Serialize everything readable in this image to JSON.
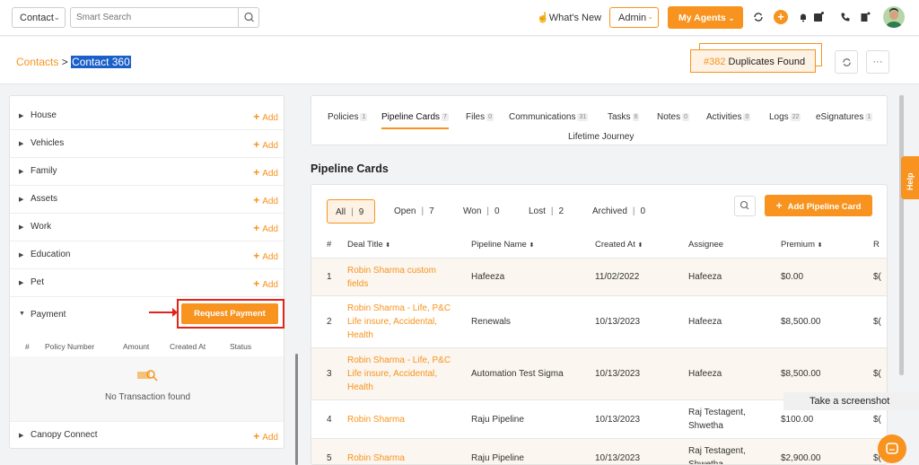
{
  "topbar": {
    "entity_select": "Contact",
    "search_placeholder": "Smart Search",
    "whats_new": "What's New",
    "admin_label": "Admin",
    "my_agents_label": "My Agents",
    "accent": "#f7931e"
  },
  "subbar": {
    "crumb_root": "Contacts",
    "crumb_sep": " > ",
    "crumb_current": "Contact 360",
    "dup_number": "#382",
    "dup_label": " Duplicates Found"
  },
  "left": {
    "rows": [
      {
        "label": "House",
        "add": "Add"
      },
      {
        "label": "Vehicles",
        "add": "Add"
      },
      {
        "label": "Family",
        "add": "Add"
      },
      {
        "label": "Assets",
        "add": "Add"
      },
      {
        "label": "Work",
        "add": "Add"
      },
      {
        "label": "Education",
        "add": "Add"
      },
      {
        "label": "Pet",
        "add": "Add"
      }
    ],
    "payment_label": "Payment",
    "request_payment": "Request Payment",
    "pay_cols": [
      "#",
      "Policy Number",
      "Amount",
      "Created At",
      "Status"
    ],
    "empty_msg": "No Transaction found",
    "canopy_label": "Canopy Connect",
    "canopy_add": "Add"
  },
  "tabs": [
    {
      "label": "Policies",
      "count": "1"
    },
    {
      "label": "Pipeline Cards",
      "count": "7"
    },
    {
      "label": "Files",
      "count": "0"
    },
    {
      "label": "Communications",
      "count": "31"
    },
    {
      "label": "Tasks",
      "count": "6"
    },
    {
      "label": "Notes",
      "count": "0"
    },
    {
      "label": "Activities",
      "count": "0"
    },
    {
      "label": "Logs",
      "count": "22"
    },
    {
      "label": "eSignatures",
      "count": "1"
    }
  ],
  "tab_lifetime": "Lifetime Journey",
  "pipeline": {
    "title": "Pipeline Cards",
    "filters": [
      {
        "label": "All",
        "count": "9"
      },
      {
        "label": "Open",
        "count": "7"
      },
      {
        "label": "Won",
        "count": "0"
      },
      {
        "label": "Lost",
        "count": "2"
      },
      {
        "label": "Archived",
        "count": "0"
      }
    ],
    "add_label": "Add Pipeline Card",
    "columns": [
      "#",
      "Deal Title",
      "Pipeline Name",
      "Created At",
      "Assignee",
      "Premium",
      "R"
    ],
    "rows": [
      {
        "n": "1",
        "deal": "Robin Sharma custom fields",
        "pipeline": "Hafeeza",
        "created": "11/02/2022",
        "assignee": "Hafeeza",
        "premium": "$0.00",
        "extra": "$("
      },
      {
        "n": "2",
        "deal": "Robin Sharma - Life, P&C Life insure, Accidental, Health",
        "pipeline": "Renewals",
        "created": "10/13/2023",
        "assignee": "Hafeeza",
        "premium": "$8,500.00",
        "extra": "$("
      },
      {
        "n": "3",
        "deal": "Robin Sharma - Life, P&C Life insure, Accidental, Health",
        "pipeline": "Automation Test Sigma",
        "created": "10/13/2023",
        "assignee": "Hafeeza",
        "premium": "$8,500.00",
        "extra": "$("
      },
      {
        "n": "4",
        "deal": "Robin Sharma",
        "pipeline": "Raju Pipeline",
        "created": "10/13/2023",
        "assignee": "Raj Testagent, Shwetha",
        "premium": "$100.00",
        "extra": "$("
      },
      {
        "n": "5",
        "deal": "Robin Sharma",
        "pipeline": "Raju Pipeline",
        "created": "10/13/2023",
        "assignee": "Raj Testagent, Shwetha",
        "premium": "$2,900.00",
        "extra": "$("
      }
    ]
  },
  "help_label": "Help",
  "tooltip": "Take a screenshot"
}
